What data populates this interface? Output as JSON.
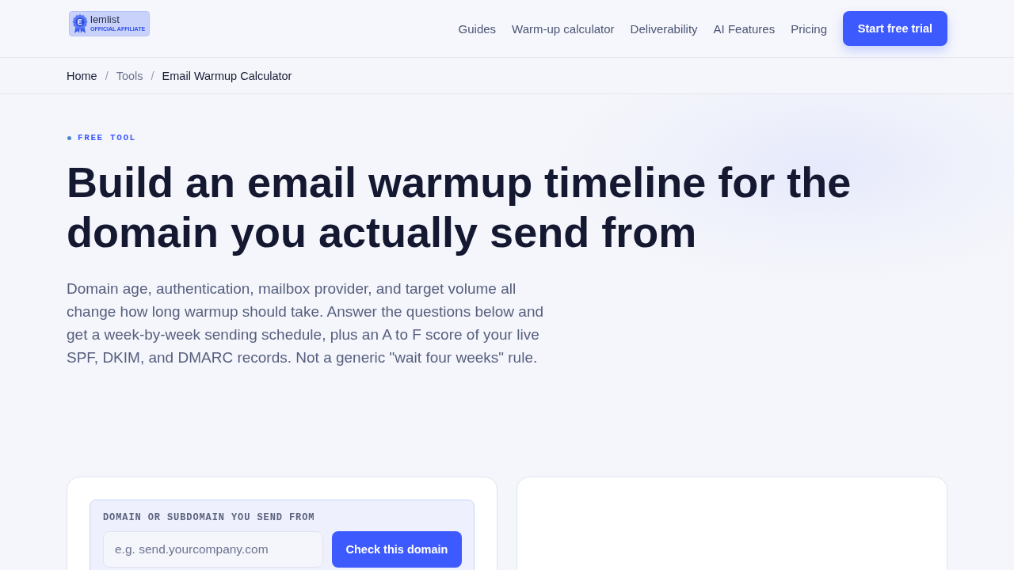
{
  "header": {
    "logo": {
      "wordmark": "lemlist",
      "tagline": "OFFICIAL AFFILIATE"
    },
    "nav": [
      {
        "label": "Guides"
      },
      {
        "label": "Warm-up calculator"
      },
      {
        "label": "Deliverability"
      },
      {
        "label": "AI Features"
      },
      {
        "label": "Pricing"
      }
    ],
    "cta": "Start free trial"
  },
  "breadcrumb": {
    "items": [
      {
        "label": "Home",
        "muted": false
      },
      {
        "label": "Tools",
        "muted": true
      },
      {
        "label": "Email Warmup Calculator",
        "muted": false
      }
    ],
    "separators": [
      "/",
      "/"
    ]
  },
  "hero": {
    "eyebrow": "FREE TOOL",
    "title": "Build an email warmup timeline for the domain you actually send from",
    "intro": "Domain age, authentication, mailbox provider, and target volume all change how long warmup should take. Answer the questions below and get a week-by-week sending schedule, plus an A to F score of your live SPF, DKIM, and DMARC records. Not a generic \"wait four weeks\" rule."
  },
  "checker": {
    "label": "DOMAIN OR SUBDOMAIN YOU SEND FROM",
    "field": {
      "placeholder": "e.g. send.yourcompany.com"
    },
    "button": "Check this domain"
  }
}
